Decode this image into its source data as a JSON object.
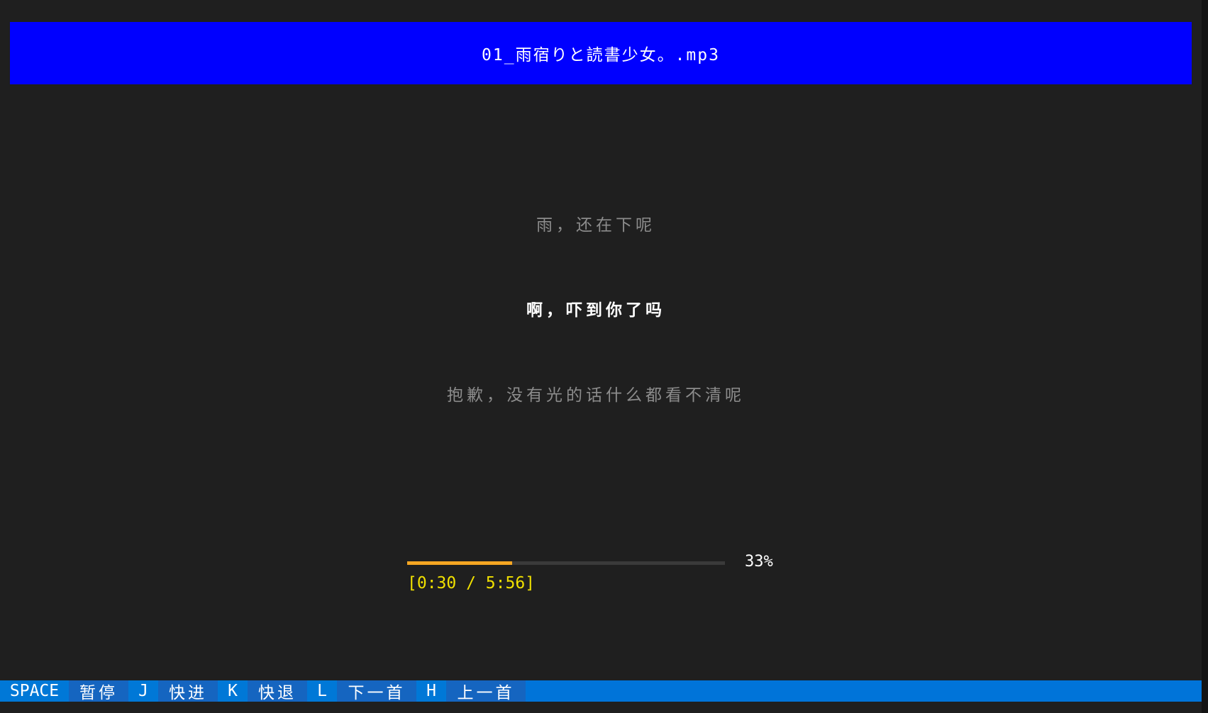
{
  "player": {
    "track_title": "01_雨宿りと読書少女。.mp3"
  },
  "lyrics": {
    "previous": "雨，还在下呢",
    "current": "啊，吓到你了吗",
    "next": "抱歉，没有光的话什么都看不清呢"
  },
  "progress": {
    "fraction": 0.33,
    "percent_label": "33%",
    "time_label": "[0:30 / 5:56]",
    "colors": {
      "fill": "#f5a623",
      "track": "#3a3a3a",
      "time": "#f0e000"
    }
  },
  "hotkeys": [
    {
      "key": "SPACE",
      "action": "暂停"
    },
    {
      "key": "J",
      "action": "快进"
    },
    {
      "key": "K",
      "action": "快退"
    },
    {
      "key": "L",
      "action": "下一首"
    },
    {
      "key": "H",
      "action": "上一首"
    }
  ],
  "colors": {
    "background": "#1f1f1f",
    "title_bar": "#0000ff",
    "hotkey_bar": "#0074d9"
  }
}
